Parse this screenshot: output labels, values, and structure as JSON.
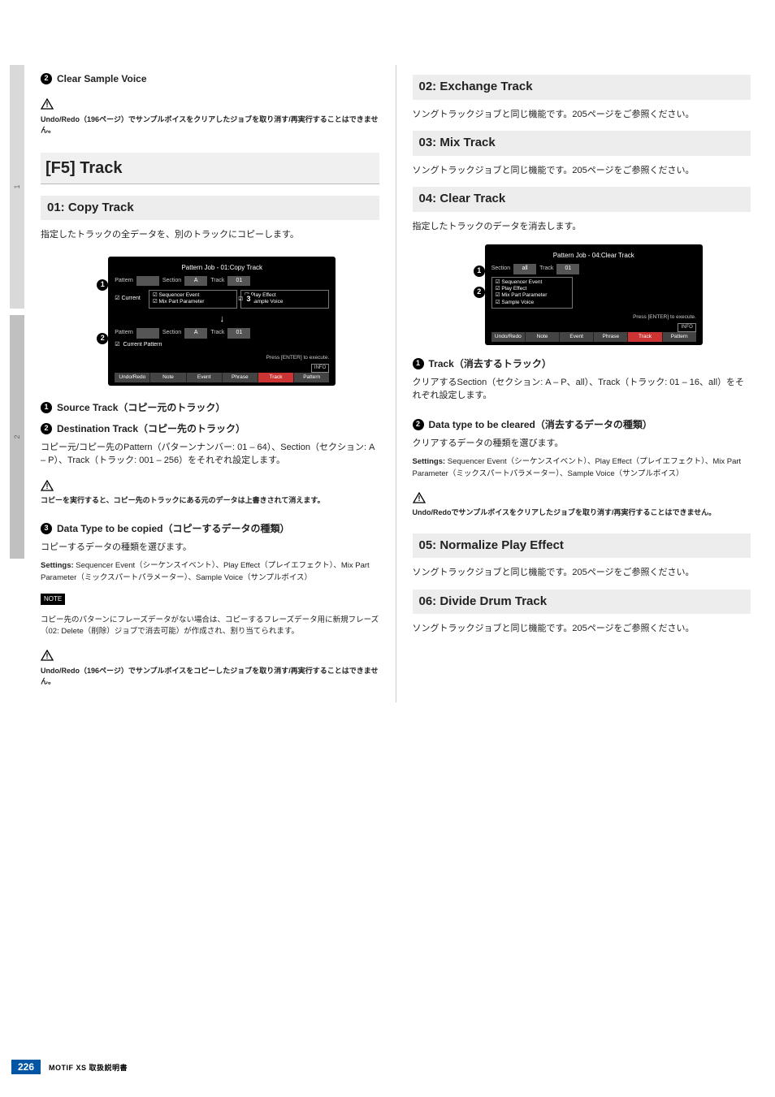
{
  "sidetabs": {
    "t1": "1",
    "t2": "2"
  },
  "left": {
    "clearSampleHeader": "Clear Sample Voice",
    "warn1_undo": "Undo/Redo（196ページ）でサンプルボイスをクリアしたジョブを取り消す/再実行することはできません。",
    "h1": "[F5] Track",
    "h2_01": "01: Copy Track",
    "copy_desc": "指定したトラックの全データを、別のトラックにコピーします。",
    "sbox1": {
      "title": "Pattern Job - 01:Copy Track",
      "row1": {
        "pat": "Pattern",
        "sec": "Section",
        "secv": "A",
        "trk": "Track",
        "trkv": "01"
      },
      "cur": "Current",
      "panel1": {
        "a": "Sequencer Event",
        "b": "Mix Part Parameter",
        "c": "Play Effect",
        "d": "Sample Voice"
      },
      "row2": {
        "pat": "Pattern",
        "sec": "Section",
        "secv": "A",
        "trk": "Track",
        "trkv": "01"
      },
      "cur2": "Current Pattern",
      "press": "Press [ENTER] to execute.",
      "info": "INFO",
      "tabs": {
        "a": "Undo/Redo",
        "b": "Note",
        "c": "Event",
        "d": "Phrase",
        "e": "Track",
        "f": "Pattern"
      }
    },
    "srcHeader": "Source Track（コピー元のトラック）",
    "dstHeader": "Destination Track（コピー先のトラック）",
    "dst_desc": "コピー元/コピー先のPattern（パターンナンバー: 01 – 64）、Section（セクション: A – P）、Track（トラック: 001 – 256）をそれぞれ設定します。",
    "warn2": "コピーを実行すると、コピー先のトラックにある元のデータは上書きされて消えます。",
    "dtHeader": "Data Type to be copied（コピーするデータの種類）",
    "dt_desc": "コピーするデータの種類を選びます。",
    "dt_settings_lead": "Settings:",
    "dt_settings": "Sequencer Event（シーケンスイベント）、Play Effect（プレイエフェクト）、Mix Part Parameter（ミックスパートパラメーター）、Sample Voice（サンプルボイス）",
    "noteTag": "NOTE",
    "note_text": "コピー先のパターンにフレーズデータがない場合は、コピーするフレーズデータ用に新規フレーズ（02: Delete（削除）ジョブで消去可能）が作成され、割り当てられます。",
    "warn3_undo": "Undo/Redo（196ページ）でサンプルボイスをコピーしたジョブを取り消す/再実行することはできません。"
  },
  "right": {
    "h02": "02: Exchange Track",
    "t02_desc": "ソングトラックジョブと同じ機能です。205ページをご参照ください。",
    "h03": "03: Mix Track",
    "t03_desc": "ソングトラックジョブと同じ機能です。205ページをご参照ください。",
    "h04": "04: Clear Track",
    "t04_desc": "指定したトラックのデータを消去します。",
    "sbox2": {
      "title": "Pattern Job - 04:Clear Track",
      "sec": "Section",
      "secv": "all",
      "trk": "Track",
      "trkv": "01",
      "panel": {
        "a": "Sequencer Event",
        "b": "Play Effect",
        "c": "Mix Part Parameter",
        "d": "Sample Voice"
      },
      "press": "Press [ENTER] to execute.",
      "info": "INFO",
      "tabs": {
        "a": "Undo/Redo",
        "b": "Note",
        "c": "Event",
        "d": "Phrase",
        "e": "Track",
        "f": "Pattern"
      }
    },
    "trackHeader": "Track（消去するトラック）",
    "track_desc": "クリアするSection（セクション: A – P、all）、Track（トラック: 01 – 16、all）をそれぞれ設定します。",
    "dtHeader": "Data type to be cleared（消去するデータの種類）",
    "dt_desc": "クリアするデータの種類を選びます。",
    "dt_settings_lead": "Settings:",
    "dt_settings": "Sequencer Event（シーケンスイベント）、Play Effect（プレイエフェクト）、Mix Part Parameter（ミックスパートパラメーター）、Sample Voice（サンプルボイス）",
    "warn_undo": "Undo/Redoでサンプルボイスをクリアしたジョブを取り消す/再実行することはできません。",
    "h05": "05: Normalize Play Effect",
    "t05_desc": "ソングトラックジョブと同じ機能です。205ページをご参照ください。",
    "h06": "06: Divide Drum Track",
    "t06_desc": "ソングトラックジョブと同じ機能です。205ページをご参照ください。"
  },
  "footer": {
    "page": "226",
    "model": "MOTIF XS 取扱説明書"
  }
}
